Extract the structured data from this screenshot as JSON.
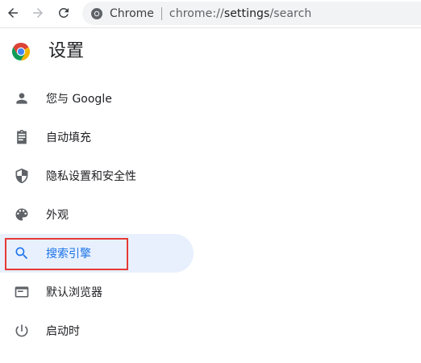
{
  "toolbar": {
    "back_icon": "arrow-left-icon",
    "forward_icon": "arrow-right-icon",
    "reload_icon": "reload-icon",
    "site_name": "Chrome",
    "url_prefix": "chrome://",
    "url_main": "settings",
    "url_suffix": "/search"
  },
  "header": {
    "title": "设置",
    "logo_icon": "chrome-logo-icon"
  },
  "sidebar": {
    "items": [
      {
        "label": "您与 Google",
        "icon": "person-icon"
      },
      {
        "label": "自动填充",
        "icon": "clipboard-icon"
      },
      {
        "label": "隐私设置和安全性",
        "icon": "shield-icon"
      },
      {
        "label": "外观",
        "icon": "palette-icon"
      },
      {
        "label": "搜索引擎",
        "icon": "search-icon",
        "active": true
      },
      {
        "label": "默认浏览器",
        "icon": "browser-window-icon"
      },
      {
        "label": "启动时",
        "icon": "power-icon"
      }
    ]
  },
  "colors": {
    "accent": "#1a73e8",
    "active_bg": "#e8f0fe",
    "highlight": "#e53935",
    "text": "#202124",
    "icon": "#5f6368"
  }
}
